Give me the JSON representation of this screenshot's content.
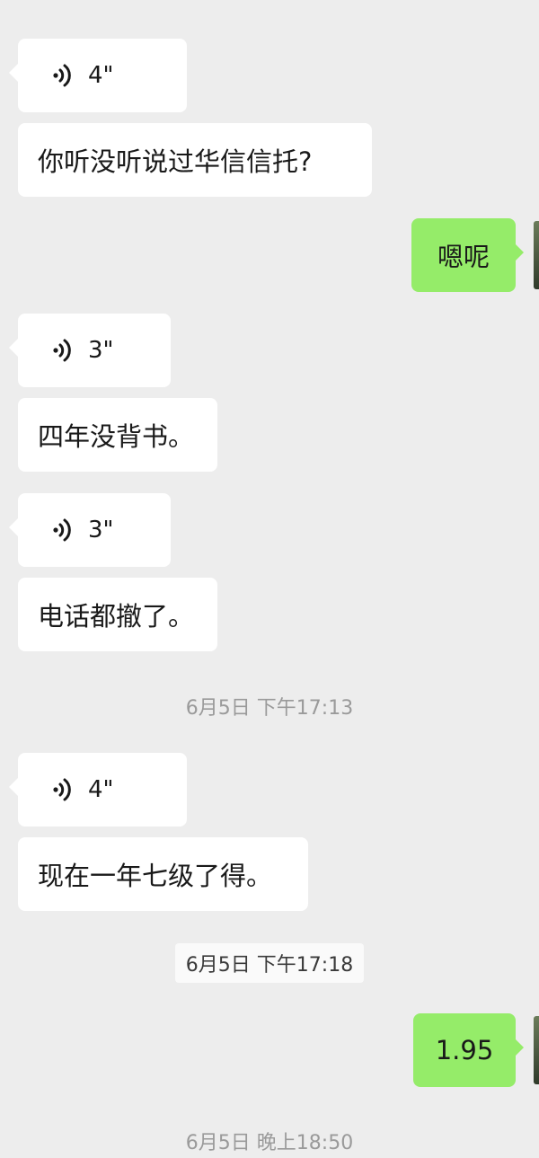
{
  "messages": [
    {
      "type": "voice",
      "duration": "4\""
    },
    {
      "type": "text",
      "text": "你听没听说过华信信托?"
    },
    {
      "type": "text",
      "text": "嗯呢",
      "sender": "me"
    },
    {
      "type": "voice",
      "duration": "3\""
    },
    {
      "type": "text",
      "text": "四年没背书。"
    },
    {
      "type": "voice",
      "duration": "3\""
    },
    {
      "type": "text",
      "text": "电话都撤了。"
    },
    {
      "type": "timestamp",
      "text": "6月5日 下午17:13"
    },
    {
      "type": "voice",
      "duration": "4\""
    },
    {
      "type": "text",
      "text": "现在一年七级了得。"
    },
    {
      "type": "timestamp",
      "text": "6月5日 下午17:18"
    },
    {
      "type": "text",
      "text": "1.95",
      "sender": "me"
    },
    {
      "type": "timestamp",
      "text": "6月5日 晚上18:50"
    }
  ],
  "colors": {
    "background": "#ededed",
    "incoming_bubble": "#ffffff",
    "outgoing_bubble": "#95ec69",
    "timestamp_text": "#9a9a9a"
  },
  "icons": {
    "voice": "voice-wave-icon"
  }
}
